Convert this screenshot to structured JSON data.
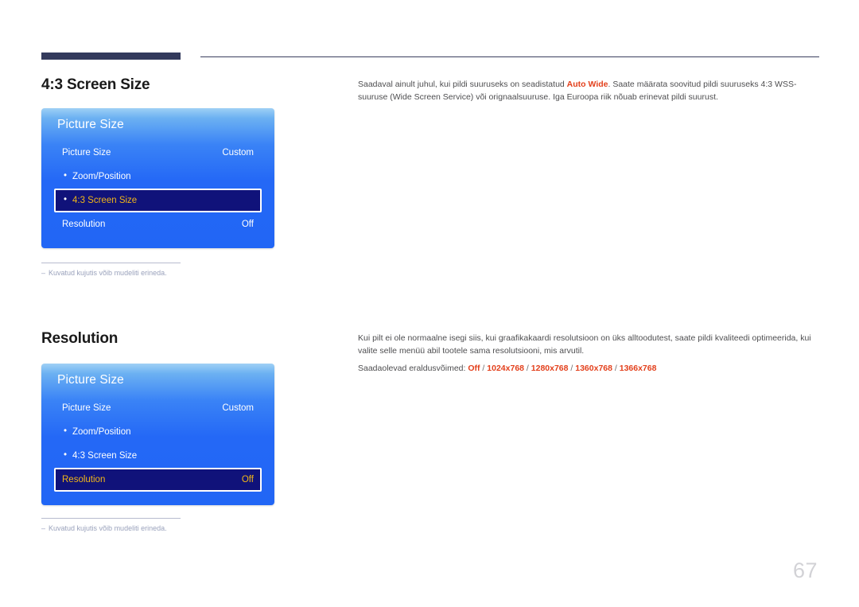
{
  "page": {
    "number": "67"
  },
  "sections": [
    {
      "heading": "4:3 Screen Size",
      "description_paragraphs": [
        {
          "parts": [
            {
              "text": "Saadaval ainult juhul, kui pildi suuruseks on seadistatud ",
              "style": "normal"
            },
            {
              "text": "Auto Wide",
              "style": "highlight"
            },
            {
              "text": ". Saate määrata soovitud pildi suuruseks 4:3 WSS-suuruse (Wide Screen Service) või orignaalsuuruse. Iga Euroopa riik nõuab erinevat pildi suurust.",
              "style": "normal"
            }
          ]
        }
      ],
      "osd": {
        "title": "Picture Size",
        "rows": [
          {
            "label": "Picture Size",
            "value": "Custom",
            "bullet": false,
            "selected": false
          },
          {
            "label": "Zoom/Position",
            "value": "",
            "bullet": true,
            "selected": false
          },
          {
            "label": "4:3 Screen Size",
            "value": "",
            "bullet": true,
            "selected": true
          },
          {
            "label": "Resolution",
            "value": "Off",
            "bullet": false,
            "selected": false
          }
        ]
      },
      "footnote": {
        "dash": "–",
        "text": "Kuvatud kujutis võib mudeliti erineda."
      }
    },
    {
      "heading": "Resolution",
      "description_paragraphs": [
        {
          "parts": [
            {
              "text": "Kui pilt ei ole normaalne isegi siis, kui graafikakaardi resolutsioon on üks alltoodutest, saate pildi kvaliteedi optimeerida, kui valite selle menüü abil tootele sama resolutsiooni, mis arvutil.",
              "style": "normal"
            }
          ]
        },
        {
          "parts": [
            {
              "text": "Saadaolevad eraldusvõimed: ",
              "style": "normal"
            },
            {
              "text": "Off",
              "style": "highlight"
            },
            {
              "text": " / ",
              "style": "separator"
            },
            {
              "text": "1024x768",
              "style": "highlight"
            },
            {
              "text": " / ",
              "style": "separator"
            },
            {
              "text": "1280x768",
              "style": "highlight"
            },
            {
              "text": " / ",
              "style": "separator"
            },
            {
              "text": "1360x768",
              "style": "highlight"
            },
            {
              "text": " / ",
              "style": "separator"
            },
            {
              "text": "1366x768",
              "style": "highlight"
            }
          ]
        }
      ],
      "osd": {
        "title": "Picture Size",
        "rows": [
          {
            "label": "Picture Size",
            "value": "Custom",
            "bullet": false,
            "selected": false
          },
          {
            "label": "Zoom/Position",
            "value": "",
            "bullet": true,
            "selected": false
          },
          {
            "label": "4:3 Screen Size",
            "value": "",
            "bullet": true,
            "selected": false
          },
          {
            "label": "Resolution",
            "value": "Off",
            "bullet": false,
            "selected": true
          }
        ]
      },
      "footnote": {
        "dash": "–",
        "text": "Kuvatud kujutis võib mudeliti erineda."
      }
    }
  ],
  "colors": {
    "accent_red": "#e3401c",
    "osd_blue_top": "#9fd0f5",
    "osd_blue_bottom": "#2166f5",
    "osd_selected_bg": "#10127a",
    "osd_selected_text": "#f2b617",
    "rule_navy": "#333a5c"
  }
}
